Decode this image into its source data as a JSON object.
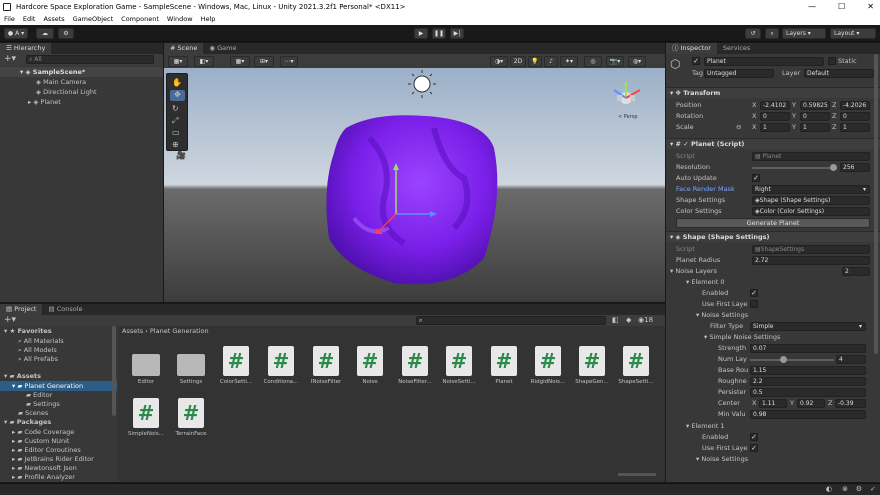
{
  "window": {
    "title": "Hardcore Space Exploration Game - SampleScene - Windows, Mac, Linux - Unity 2021.3.2f1 Personal* <DX11>"
  },
  "menu": [
    "File",
    "Edit",
    "Assets",
    "GameObject",
    "Component",
    "Window",
    "Help"
  ],
  "toolbar": {
    "account": "A",
    "layers": "Layers",
    "layout": "Layout"
  },
  "hierarchy": {
    "tab": "Hierarchy",
    "search_placeholder": "All",
    "items": [
      "SampleScene*",
      "Main Camera",
      "Directional Light",
      "Planet"
    ]
  },
  "scene": {
    "tab_scene": "Scene",
    "tab_game": "Game",
    "mode_2d": "2D",
    "view_label": "< Persp"
  },
  "project": {
    "tab_project": "Project",
    "tab_console": "Console",
    "favorites_label": "Favorites",
    "favorites": [
      "All Materials",
      "All Models",
      "All Prefabs"
    ],
    "assets_label": "Assets",
    "assets_tree": [
      "Planet Generation",
      "Editor",
      "Settings",
      "Scenes"
    ],
    "packages_label": "Packages",
    "packages": [
      "Code Coverage",
      "Custom NUnit",
      "Editor Coroutines",
      "JetBrains Rider Editor",
      "Newtonsoft Json",
      "Profile Analyzer"
    ],
    "breadcrumb": [
      "Assets",
      "Planet Generation"
    ],
    "hidden_count": "18",
    "files": [
      {
        "name": "Editor",
        "kind": "folder"
      },
      {
        "name": "Settings",
        "kind": "folder"
      },
      {
        "name": "ColorSetti...",
        "kind": "script"
      },
      {
        "name": "Conditiona...",
        "kind": "script"
      },
      {
        "name": "INoiseFilter",
        "kind": "script"
      },
      {
        "name": "Noise",
        "kind": "script"
      },
      {
        "name": "NoiseFilter...",
        "kind": "script"
      },
      {
        "name": "NoiseSetti...",
        "kind": "script"
      },
      {
        "name": "Planet",
        "kind": "script"
      },
      {
        "name": "RidgidNois...",
        "kind": "script"
      },
      {
        "name": "ShapeGen...",
        "kind": "script"
      },
      {
        "name": "ShapeSetti...",
        "kind": "script"
      },
      {
        "name": "SimpleNois...",
        "kind": "script"
      },
      {
        "name": "TerrainFace",
        "kind": "script"
      }
    ]
  },
  "inspector": {
    "tab_inspector": "Inspector",
    "tab_services": "Services",
    "object_name": "Planet",
    "static_label": "Static",
    "tag_label": "Tag",
    "tag_value": "Untagged",
    "layer_label": "Layer",
    "layer_value": "Default",
    "transform": {
      "header": "Transform",
      "position_label": "Position",
      "position": [
        "-2.4102",
        "0.59825",
        "-4.2026"
      ],
      "rotation_label": "Rotation",
      "rotation": [
        "0",
        "0",
        "0"
      ],
      "scale_label": "Scale",
      "scale": [
        "1",
        "1",
        "1"
      ]
    },
    "planet_script": {
      "header": "Planet (Script)",
      "script_label": "Script",
      "script_value": "Planet",
      "resolution_label": "Resolution",
      "resolution_value": "256",
      "resolution_fraction": 0.97,
      "auto_update_label": "Auto Update",
      "face_render_mask_label": "Face Render Mask",
      "face_render_mask_value": "Right",
      "shape_settings_label": "Shape Settings",
      "shape_settings_value": "Shape (Shape Settings)",
      "color_settings_label": "Color Settings",
      "color_settings_value": "Color (Color Settings)",
      "generate_button": "Generate Planet"
    },
    "shape_settings": {
      "header": "Shape (Shape Settings)",
      "script_label": "Script",
      "script_value": "ShapeSettings",
      "planet_radius_label": "Planet Radius",
      "planet_radius_value": "2.72",
      "noise_layers_label": "Noise Layers",
      "noise_layers_count": "2",
      "element0": "Element 0",
      "enabled_label": "Enabled",
      "use_first_layer_label": "Use First Laye",
      "noise_settings_label": "Noise Settings",
      "filter_type_label": "Filter Type",
      "filter_type_value": "Simple",
      "simple_noise_label": "Simple Noise Settings",
      "strength_label": "Strength",
      "strength_value": "0.07",
      "num_layers_label": "Num Lay",
      "num_layers_value": "4",
      "num_layers_fraction": 0.4,
      "base_rough_label": "Base Rou",
      "base_rough_value": "1.15",
      "roughness_label": "Roughne",
      "roughness_value": "2.2",
      "persistence_label": "Persister",
      "persistence_value": "0.5",
      "center_label": "Center",
      "center": [
        "1.11",
        "0.92",
        "-0.39"
      ],
      "min_value_label": "Min Valu",
      "min_value": "0.98",
      "element1": "Element 1",
      "enabled1_label": "Enabled",
      "use_first_layer1_label": "Use First Laye",
      "noise_settings1_label": "Noise Settings"
    }
  }
}
